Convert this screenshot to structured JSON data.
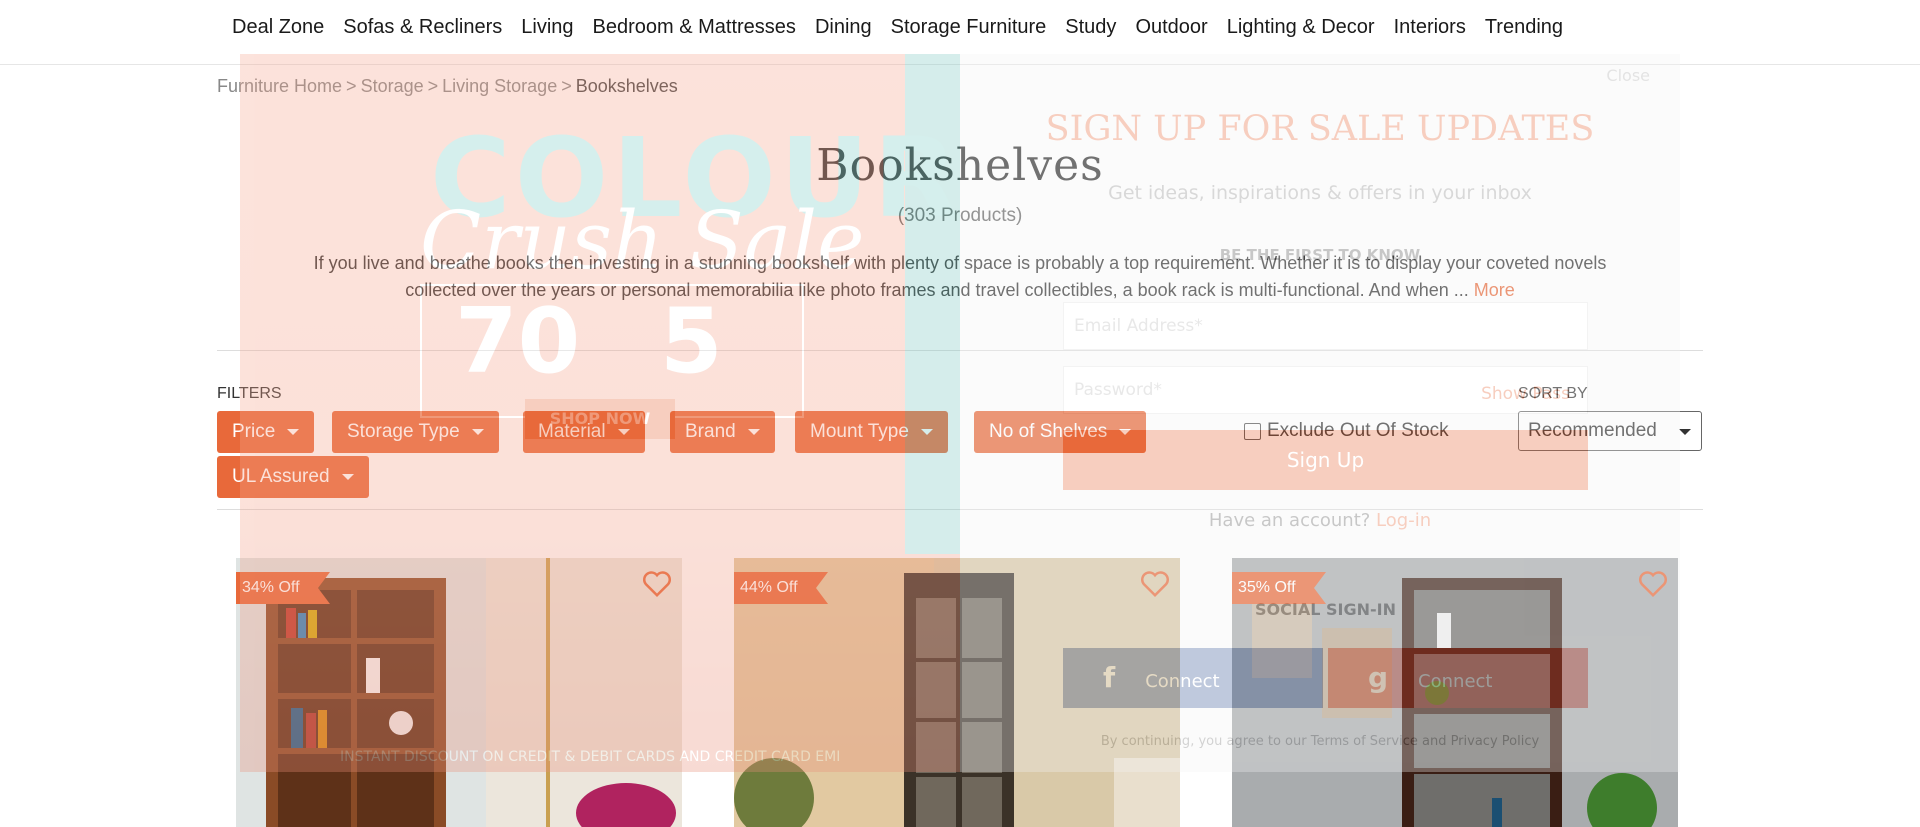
{
  "nav": {
    "items": [
      "Deal Zone",
      "Sofas & Recliners",
      "Living",
      "Bedroom & Mattresses",
      "Dining",
      "Storage Furniture",
      "Study",
      "Outdoor",
      "Lighting & Decor",
      "Interiors",
      "Trending"
    ]
  },
  "breadcrumb": {
    "items": [
      "Furniture Home",
      "Storage",
      "Living Storage"
    ],
    "current": "Bookshelves",
    "separator": ">"
  },
  "page": {
    "title": "Bookshelves",
    "count": "(303 Products)",
    "description_line1": "If you live and breathe books then investing in a stunning bookshelf with plenty of space is probably a top requirement. Whether it is to display your coveted novels",
    "description_line2": "collected over the years or personal memorabilia like photo frames and travel collectibles, a book rack is multi-functional. And when ...",
    "more_label": "More"
  },
  "filters": {
    "label": "FILTERS",
    "buttons": [
      "Price",
      "Storage Type",
      "Material",
      "Brand",
      "Mount Type",
      "No of Shelves",
      "UL Assured"
    ],
    "exclude_label": "Exclude Out Of Stock",
    "exclude_checked": false
  },
  "sort": {
    "label": "SORT BY",
    "selected": "Recommended"
  },
  "products": [
    {
      "discount": "34% Off"
    },
    {
      "discount": "44% Off"
    },
    {
      "discount": "35% Off"
    }
  ],
  "overlay": {
    "promo_word1": "COLOUR",
    "promo_word2": "Crush Sale",
    "promo_pct1": "70",
    "promo_pct2": "5",
    "promo_shop": "SHOP NOW",
    "promo_bank": "INSTANT DISCOUNT ON CREDIT & DEBIT CARDS AND CREDIT CARD EMI",
    "close": "Close",
    "title": "SIGN UP FOR SALE UPDATES",
    "subtitle": "Get ideas, inspirations & offers in your inbox",
    "first_to_know": "BE THE FIRST TO KNOW",
    "email_placeholder": "Email Address*",
    "password_placeholder": "Password*",
    "show_password": "Show Pass",
    "signup": "Sign Up",
    "have_account": "Have an account?",
    "login": "Log-in",
    "social": "SOCIAL SIGN-IN",
    "connect": "Connect",
    "terms": "By continuing, you agree to our Terms of Service and Privacy Policy"
  },
  "colors": {
    "accent": "#e8693a",
    "text": "#222222"
  }
}
